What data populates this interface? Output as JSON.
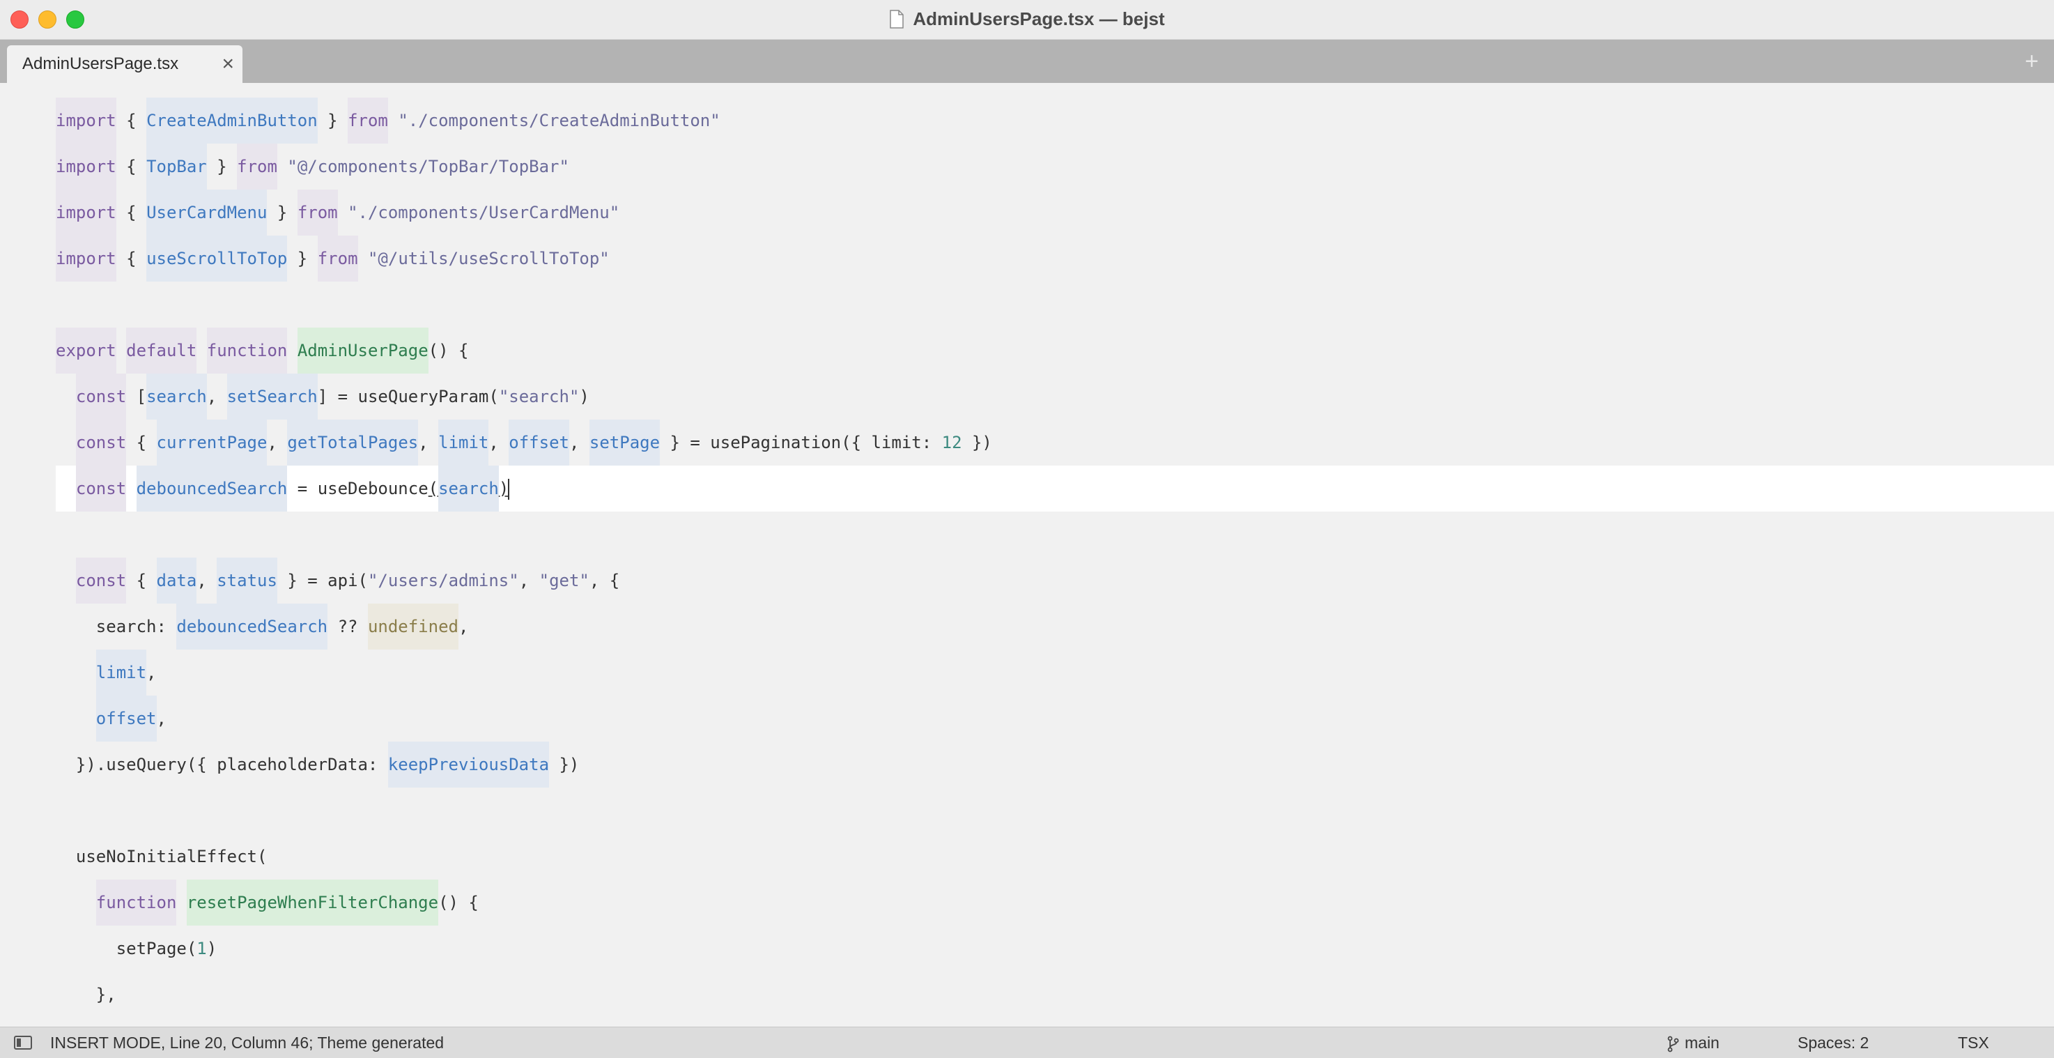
{
  "window": {
    "title": "AdminUsersPage.tsx — bejst"
  },
  "tabs": [
    {
      "label": "AdminUsersPage.tsx",
      "close": "×"
    }
  ],
  "new_tab": "+",
  "editor": {
    "lines": [
      [
        [
          "kw",
          "import"
        ],
        [
          "p",
          " { "
        ],
        [
          "id",
          "CreateAdminButton"
        ],
        [
          "p",
          " } "
        ],
        [
          "kw",
          "from"
        ],
        [
          "p",
          " "
        ],
        [
          "str",
          "\"./components/CreateAdminButton\""
        ]
      ],
      [
        [
          "kw",
          "import"
        ],
        [
          "p",
          " { "
        ],
        [
          "id",
          "TopBar"
        ],
        [
          "p",
          " } "
        ],
        [
          "kw",
          "from"
        ],
        [
          "p",
          " "
        ],
        [
          "str",
          "\"@/components/TopBar/TopBar\""
        ]
      ],
      [
        [
          "kw",
          "import"
        ],
        [
          "p",
          " { "
        ],
        [
          "id",
          "UserCardMenu"
        ],
        [
          "p",
          " } "
        ],
        [
          "kw",
          "from"
        ],
        [
          "p",
          " "
        ],
        [
          "str",
          "\"./components/UserCardMenu\""
        ]
      ],
      [
        [
          "kw",
          "import"
        ],
        [
          "p",
          " { "
        ],
        [
          "id",
          "useScrollToTop"
        ],
        [
          "p",
          " } "
        ],
        [
          "kw",
          "from"
        ],
        [
          "p",
          " "
        ],
        [
          "str",
          "\"@/utils/useScrollToTop\""
        ]
      ],
      [],
      [
        [
          "kw",
          "export"
        ],
        [
          "p",
          " "
        ],
        [
          "kw",
          "default"
        ],
        [
          "p",
          " "
        ],
        [
          "kw",
          "function"
        ],
        [
          "p",
          " "
        ],
        [
          "fn",
          "AdminUserPage"
        ],
        [
          "p",
          "() {"
        ]
      ],
      [
        [
          "p",
          "  "
        ],
        [
          "kw",
          "const"
        ],
        [
          "p",
          " ["
        ],
        [
          "id",
          "search"
        ],
        [
          "p",
          ", "
        ],
        [
          "id",
          "setSearch"
        ],
        [
          "p",
          "] = useQueryParam("
        ],
        [
          "str",
          "\"search\""
        ],
        [
          "p",
          ")"
        ]
      ],
      [
        [
          "p",
          "  "
        ],
        [
          "kw",
          "const"
        ],
        [
          "p",
          " { "
        ],
        [
          "id",
          "currentPage"
        ],
        [
          "p",
          ", "
        ],
        [
          "id",
          "getTotalPages"
        ],
        [
          "p",
          ", "
        ],
        [
          "id",
          "limit"
        ],
        [
          "p",
          ", "
        ],
        [
          "id",
          "offset"
        ],
        [
          "p",
          ", "
        ],
        [
          "id",
          "setPage"
        ],
        [
          "p",
          " } = usePagination({ limit: "
        ],
        [
          "num",
          "12"
        ],
        [
          "p",
          " })"
        ]
      ],
      [
        [
          "p",
          "  "
        ],
        [
          "kw",
          "const"
        ],
        [
          "p",
          " "
        ],
        [
          "id",
          "debouncedSearch"
        ],
        [
          "p",
          " = useDebounce"
        ],
        [
          "u",
          "("
        ],
        [
          "id",
          "search"
        ],
        [
          "u",
          ")"
        ],
        [
          "cursor",
          ""
        ]
      ],
      [],
      [
        [
          "p",
          "  "
        ],
        [
          "kw",
          "const"
        ],
        [
          "p",
          " { "
        ],
        [
          "id",
          "data"
        ],
        [
          "p",
          ", "
        ],
        [
          "id",
          "status"
        ],
        [
          "p",
          " } = api("
        ],
        [
          "str",
          "\"/users/admins\""
        ],
        [
          "p",
          ", "
        ],
        [
          "str",
          "\"get\""
        ],
        [
          "p",
          ", {"
        ]
      ],
      [
        [
          "p",
          "    search: "
        ],
        [
          "id",
          "debouncedSearch"
        ],
        [
          "p",
          " ?? "
        ],
        [
          "und",
          "undefined"
        ],
        [
          "p",
          ","
        ]
      ],
      [
        [
          "p",
          "    "
        ],
        [
          "id",
          "limit"
        ],
        [
          "p",
          ","
        ]
      ],
      [
        [
          "p",
          "    "
        ],
        [
          "id",
          "offset"
        ],
        [
          "p",
          ","
        ]
      ],
      [
        [
          "p",
          "  }).useQuery({ placeholderData: "
        ],
        [
          "id",
          "keepPreviousData"
        ],
        [
          "p",
          " })"
        ]
      ],
      [],
      [
        [
          "p",
          "  useNoInitialEffect("
        ]
      ],
      [
        [
          "p",
          "    "
        ],
        [
          "kw",
          "function"
        ],
        [
          "p",
          " "
        ],
        [
          "fn",
          "resetPageWhenFilterChange"
        ],
        [
          "p",
          "() {"
        ]
      ],
      [
        [
          "p",
          "      setPage("
        ],
        [
          "num",
          "1"
        ],
        [
          "p",
          ")"
        ]
      ],
      [
        [
          "p",
          "    },"
        ]
      ]
    ],
    "current_line_index": 8
  },
  "status": {
    "mode": "INSERT MODE, Line 20, Column 46; Theme generated",
    "branch": "main",
    "spaces": "Spaces: 2",
    "syntax": "TSX"
  },
  "colors": {
    "keyword": "#7a5aa0",
    "identifier": "#3e78bf",
    "string": "#6b6b9a",
    "number": "#3d8a80",
    "function_def": "#2e7d4f"
  }
}
